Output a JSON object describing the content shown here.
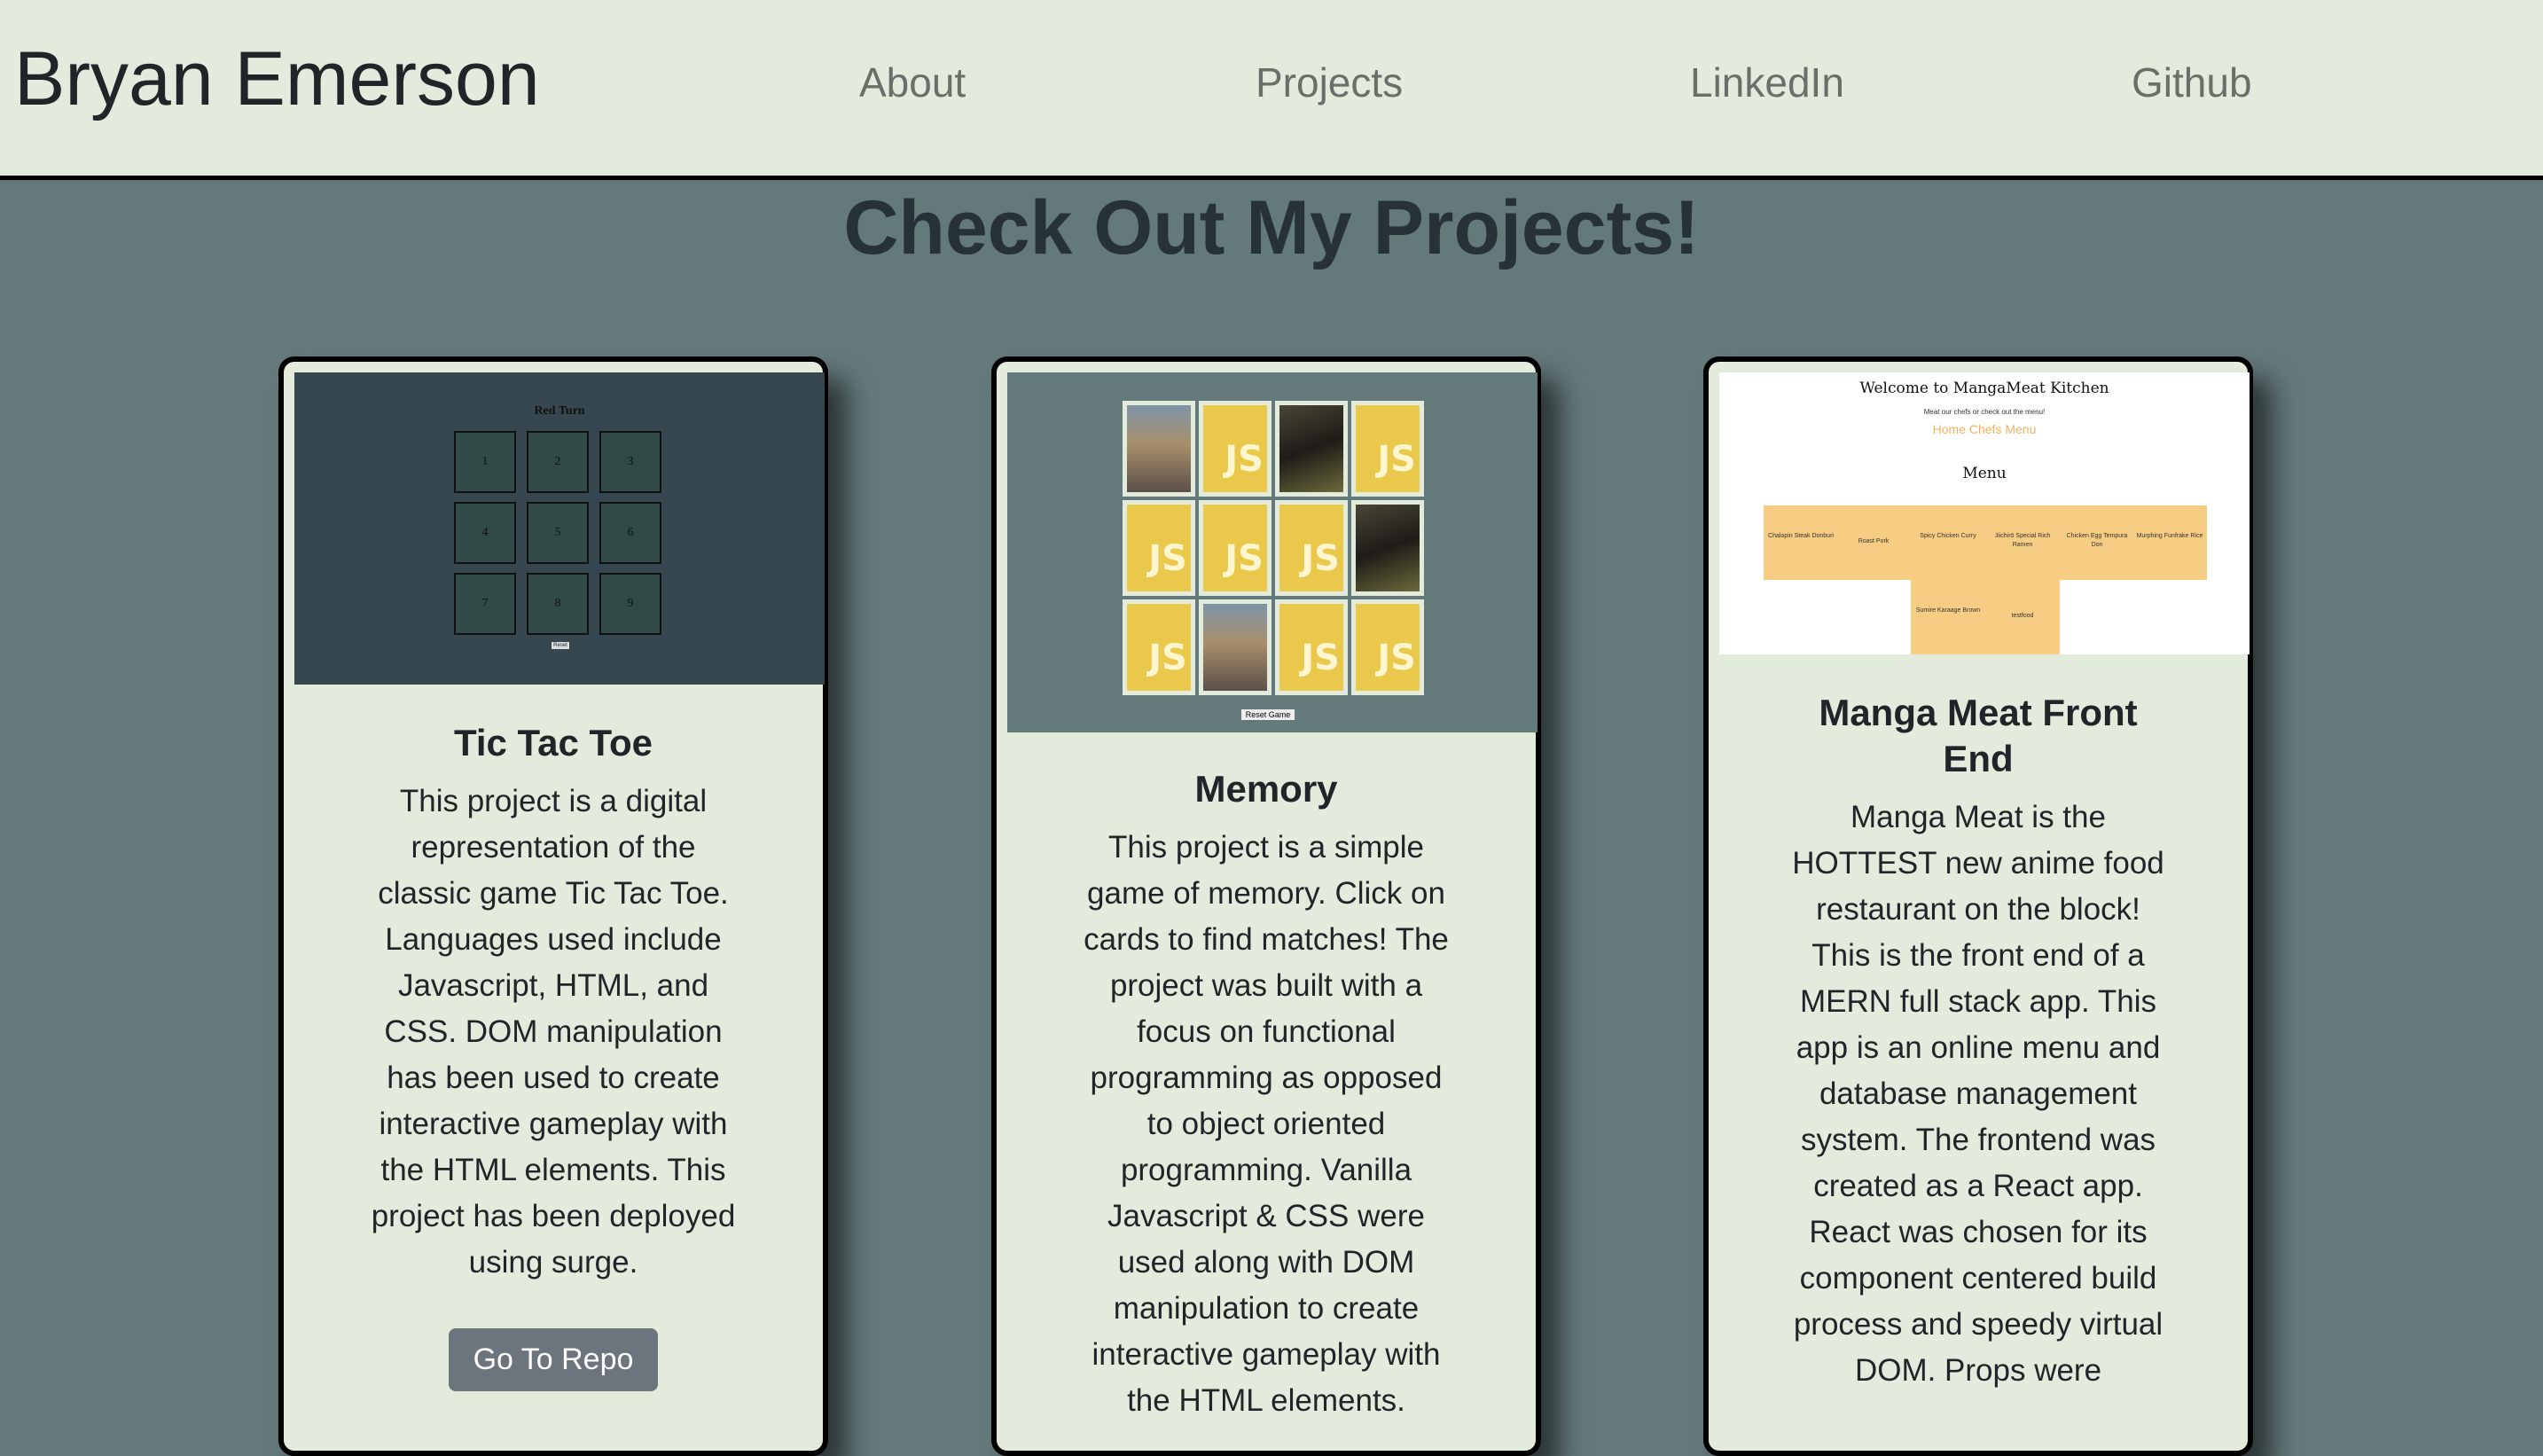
{
  "navbar": {
    "brand": "Bryan Emerson",
    "links": [
      "About",
      "Projects",
      "LinkedIn",
      "Github"
    ]
  },
  "page": {
    "title": "Check Out My Projects!"
  },
  "cards": [
    {
      "title": "Tic Tac Toe",
      "text": "This project is a digital representation of the classic game Tic Tac Toe. Languages used include Javascript, HTML, and CSS. DOM manipulation has been used to create interactive gameplay with the HTML elements. This project has been deployed using surge.",
      "button": "Go To Repo",
      "thumb": {
        "title": "Red Turn",
        "cells": [
          "1",
          "2",
          "3",
          "4",
          "5",
          "6",
          "7",
          "8",
          "9"
        ],
        "reset": "Reset"
      }
    },
    {
      "title": "Memory",
      "text": "This project is a simple game of memory. Click on cards to find matches! The project was built with a focus on functional programming as opposed to object oriented programming. Vanilla Javascript & CSS were used along with DOM manipulation to create interactive gameplay with the HTML elements.",
      "thumb": {
        "cards": [
          "girl",
          "js",
          "dog",
          "js",
          "js",
          "js",
          "js",
          "dog",
          "js",
          "girl",
          "js",
          "js"
        ],
        "js_label": "JS",
        "reset": "Reset Game"
      }
    },
    {
      "title": "Manga Meat Front End",
      "text": "Manga Meat is the HOTTEST new anime food restaurant on the block! This is the front end of a MERN full stack app. This app is an online menu and database management system. The frontend was created as a React app. React was chosen for its component centered build process and speedy virtual DOM. Props were",
      "thumb": {
        "title": "Welcome to MangaMeat Kitchen",
        "subtitle": "Meat our chefs or check out the menu!",
        "nav": "Home  Chefs  Menu",
        "menu": "Menu",
        "items": [
          "Chalapin Steak Donburi",
          "Roast Pork",
          "Spicy Chicken Curry",
          "Jiichirō Special Rich Ramen",
          "Chicken Egg Tempura Don",
          "Murphing Funfrake Rice",
          "Sumire Karaage Brown",
          "testfood"
        ]
      }
    }
  ],
  "colors": {
    "background": "#64797a",
    "card": "#e3ecdc",
    "nav": "#e3ecdc",
    "button": "#6c757d"
  }
}
